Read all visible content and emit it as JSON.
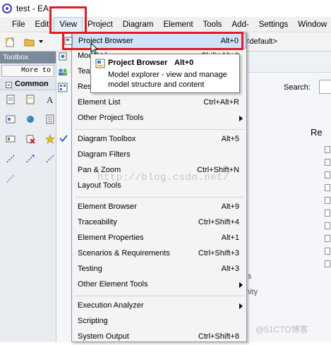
{
  "window": {
    "title": "test - EA"
  },
  "menubar": {
    "items": [
      "File",
      "Edit",
      "View",
      "Project",
      "Diagram",
      "Element",
      "Tools",
      "Add-Ins",
      "Settings",
      "Window"
    ]
  },
  "toolbar": {
    "default_text": "<default>"
  },
  "toolbox": {
    "header": "Toolbox",
    "more_tools": "More to",
    "section": "Common"
  },
  "right": {
    "search_label": "Search:",
    "tree_partial": "Re",
    "faded_1": "s",
    "faded_2": "nity"
  },
  "view_menu": {
    "items": [
      {
        "label": "Project Browser",
        "shortcut": "Alt+0"
      },
      {
        "label": "Model View",
        "shortcut": "Shift+Alt+0"
      },
      {
        "label": "Team Review",
        "shortcut": ""
      },
      {
        "label": "Resources",
        "shortcut": ""
      },
      {
        "label": "Element List",
        "shortcut": "Ctrl+Alt+R"
      },
      {
        "label": "Other Project Tools",
        "shortcut": ""
      },
      {
        "label": "Diagram Toolbox",
        "shortcut": "Alt+5"
      },
      {
        "label": "Diagram Filters",
        "shortcut": ""
      },
      {
        "label": "Pan & Zoom",
        "shortcut": "Ctrl+Shift+N"
      },
      {
        "label": "Layout Tools",
        "shortcut": ""
      },
      {
        "label": "Element Browser",
        "shortcut": "Alt+9"
      },
      {
        "label": "Traceability",
        "shortcut": "Ctrl+Shift+4"
      },
      {
        "label": "Element Properties",
        "shortcut": "Alt+1"
      },
      {
        "label": "Scenarios & Requirements",
        "shortcut": "Ctrl+Shift+3"
      },
      {
        "label": "Testing",
        "shortcut": "Alt+3"
      },
      {
        "label": "Other Element Tools",
        "shortcut": ""
      },
      {
        "label": "Execution Analyzer",
        "shortcut": ""
      },
      {
        "label": "Scripting",
        "shortcut": ""
      },
      {
        "label": "System Output",
        "shortcut": "Ctrl+Shift+8"
      }
    ]
  },
  "tooltip": {
    "title": "Project Browser",
    "shortcut": "Alt+0",
    "description": "Model explorer - view and manage model structure and content"
  },
  "watermark": "http://blog.csdn.net/",
  "corner_mark": "@51CTO博客",
  "colors": {
    "highlight": "#cfe4fa",
    "annotation_red": "#e8191f"
  }
}
